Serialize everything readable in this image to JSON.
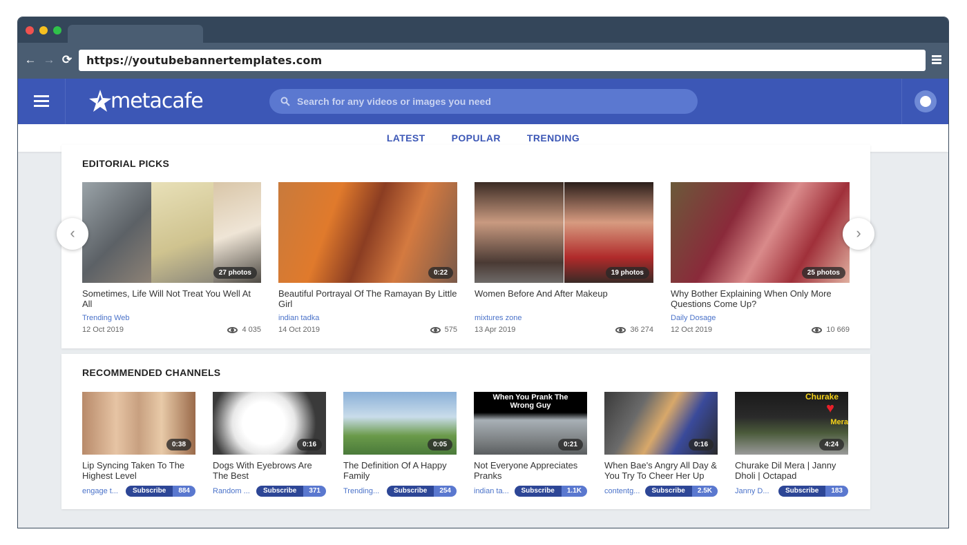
{
  "browser": {
    "url": "https://youtubebannertemplates.com"
  },
  "site": {
    "logo_text": "metacafe",
    "search_placeholder": "Search for any videos or images you need"
  },
  "subnav": [
    "LATEST",
    "POPULAR",
    "TRENDING"
  ],
  "editorial": {
    "title": "EDITORIAL PICKS",
    "items": [
      {
        "title": "Sometimes, Life Will Not Treat You Well At All",
        "channel": "Trending Web",
        "date": "12 Oct 2019",
        "views": "4 035",
        "badge": "27 photos"
      },
      {
        "title": "Beautiful Portrayal Of The Ramayan By Little Girl",
        "channel": "indian tadka",
        "date": "14 Oct 2019",
        "views": "575",
        "badge": "0:22"
      },
      {
        "title": "Women Before And After Makeup",
        "channel": "mixtures zone",
        "date": "13 Apr 2019",
        "views": "36 274",
        "badge": "19 photos"
      },
      {
        "title": "Why Bother Explaining When Only More Questions Come Up?",
        "channel": "Daily Dosage",
        "date": "12 Oct 2019",
        "views": "10 669",
        "badge": "25 photos"
      }
    ]
  },
  "channels": {
    "title": "RECOMMENDED CHANNELS",
    "items": [
      {
        "title": "Lip Syncing Taken To The Highest Level",
        "channel": "engage t...",
        "subscribe": "Subscribe",
        "count": "884",
        "badge": "0:38"
      },
      {
        "title": "Dogs With Eyebrows Are The Best",
        "channel": "Random ...",
        "subscribe": "Subscribe",
        "count": "371",
        "badge": "0:16"
      },
      {
        "title": "The Definition Of A Happy Family",
        "channel": "Trending...",
        "subscribe": "Subscribe",
        "count": "254",
        "badge": "0:05"
      },
      {
        "title": "Not Everyone Appreciates Pranks",
        "channel": "indian ta...",
        "subscribe": "Subscribe",
        "count": "1.1K",
        "badge": "0:21",
        "overlay": "When You Prank The Wrong Guy"
      },
      {
        "title": "When Bae's Angry All Day & You Try To Cheer Her Up",
        "channel": "contentg...",
        "subscribe": "Subscribe",
        "count": "2.5K",
        "badge": "0:16"
      },
      {
        "title": "Churake Dil Mera | Janny Dholi | Octapad",
        "channel": "Janny D...",
        "subscribe": "Subscribe",
        "count": "183",
        "badge": "4:24",
        "overlay": "Churake",
        "overlay2": "Mera"
      }
    ]
  }
}
